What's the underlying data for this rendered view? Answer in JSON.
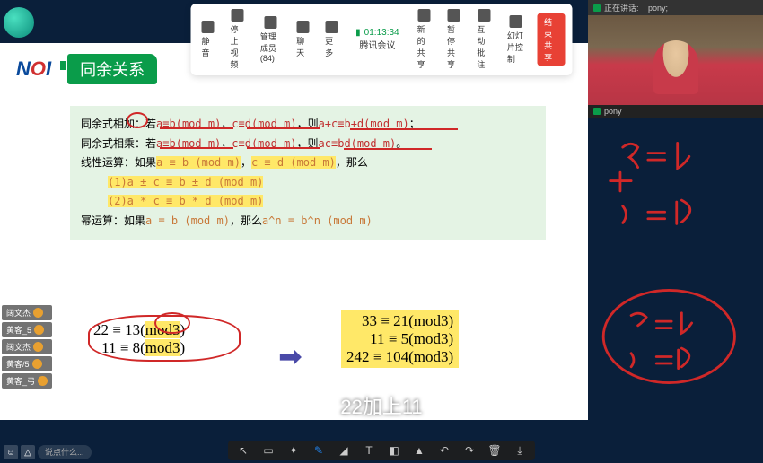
{
  "meeting": {
    "time": "01:13:34",
    "app_name": "腾讯会议",
    "toolbar": {
      "mute": "静音",
      "stop_video": "停止视频",
      "members": "管理成员(84)",
      "chat": "聊天",
      "more": "更多",
      "new_share": "新的共享",
      "pause_share": "暂停共享",
      "annotate": "互动批注",
      "slideshow": "幻灯片控制",
      "end_share": "结束共享"
    },
    "speaking_label": "正在讲话:",
    "speaking_name": "pony;",
    "presenter_name": "pony"
  },
  "slide": {
    "logo": "NOI",
    "title": "同余关系",
    "lines": {
      "l1a": "同余式相",
      "l1b": "加",
      "l1c": "：若",
      "l1d": "a≡b(mod m)",
      "l1e": "，",
      "l1f": "c≡d(mod m)",
      "l1g": "，则",
      "l1h": "a+c≡b+d(mod m)",
      "l1i": "；",
      "l2a": "同余式相乘：若",
      "l2b": "a≡b(mod m)",
      "l2c": "，",
      "l2d": "c≡d(mod m)",
      "l2e": "，则",
      "l2f": "ac≡bd(mod m)",
      "l2g": "。",
      "l3a": "线性运算：如果",
      "l3b": "a ≡ b (mod m)",
      "l3c": "，",
      "l3d": "c ≡ d (mod m)",
      "l3e": "，那么",
      "l4": "(1)a ± c ≡ b ± d (mod m)",
      "l5": "(2)a * c ≡ b * d (mod m)",
      "l6a": "幂运算：如果",
      "l6b": "a ≡ b (mod m)",
      "l6c": "，那么",
      "l6d": "a^n ≡ b^n (mod m)"
    },
    "example_left": {
      "row1": "22 ≡ 13(mod3)",
      "row2": "11 ≡ 8(mod3)"
    },
    "example_right": {
      "row1": "33 ≡ 21(mod3)",
      "row2": "11 ≡ 5(mod3)",
      "row3": "242 ≡ 104(mod3)"
    },
    "handwriting": {
      "eq1": "a ≡ b",
      "eq2": "c ≡ d",
      "plus": "+"
    }
  },
  "subtitle": "22加上11",
  "reactions": [
    "阔文杰",
    "黄客_5",
    "阔文杰",
    "黄客/5",
    "黄客_弓"
  ],
  "corner_placeholder": "说点什么..."
}
